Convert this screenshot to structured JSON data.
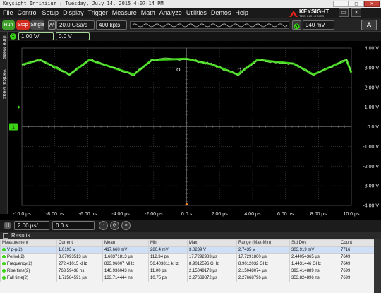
{
  "window": {
    "title": "Keysight Infiniium : Tuesday, July 14, 2015 4:07:14 PM",
    "buttons": [
      "–",
      "□",
      "✕"
    ]
  },
  "menu": {
    "items": [
      "File",
      "Control",
      "Setup",
      "Display",
      "Trigger",
      "Measure",
      "Math",
      "Analyze",
      "Utilities",
      "Demos",
      "Help"
    ],
    "logo_word": "KEYSIGHT",
    "logo_sub": "TECHNOLOGIES",
    "window_controls": [
      "▭",
      "✕"
    ]
  },
  "toolbar": {
    "run_label": "Run",
    "stop_label": "Stop",
    "single_label": "Single",
    "sample_rate": "20.0 GSa/s",
    "memory_depth": "400 kpts",
    "trigger_level": "940 mV",
    "autoscale_label": "A",
    "colors": {
      "run": "#3f9f2b",
      "stop": "#d12b1f",
      "single": "#4b4b4b"
    }
  },
  "sidetabs": [
    "Time Meas",
    "Vertical Meas"
  ],
  "channel1": {
    "badge": "1",
    "scale": "1.00 V/",
    "offset": "0.0 V",
    "color": "#3bd216"
  },
  "graticule": {
    "y_labels": [
      "4.00 V",
      "3.00 V",
      "2.00 V",
      "1.00 V",
      "0.0 V",
      "-1.00 V",
      "-2.00 V",
      "-3.00 V",
      "-4.00 V"
    ],
    "x_labels": [
      "-10.0 µs",
      "-8.00 µs",
      "-6.00 µs",
      "-4.00 µs",
      "-2.00 µs",
      "0.0 s",
      "2.00 µs",
      "4.00 µs",
      "6.00 µs",
      "8.00 µs",
      "10.0 µs"
    ],
    "ground_marker": "1",
    "trace_color": "#3bd216",
    "grid_color": "#3a3a3a"
  },
  "chart_data": {
    "type": "line",
    "title": "",
    "xlabel": "",
    "ylabel": "",
    "x_unit": "µs",
    "y_unit": "V",
    "xlim": [
      -10,
      10
    ],
    "ylim": [
      -4,
      4
    ],
    "grid": true,
    "series": [
      {
        "name": "",
        "x": [
          -10.0,
          -8.9,
          -7.1,
          -5.9,
          -3.2,
          -2.1,
          0.0,
          1.6,
          3.1,
          4.3,
          6.5,
          7.7,
          9.7,
          10.0
        ],
        "y": [
          3.15,
          3.4,
          2.65,
          3.4,
          2.65,
          3.4,
          3.45,
          3.15,
          2.65,
          3.4,
          3.2,
          2.65,
          3.4,
          2.75
        ]
      }
    ]
  },
  "horizontal": {
    "badge": "H",
    "time_scale": "2.00 µs/",
    "position": "0.0 s",
    "icons": [
      "◔",
      "⟳",
      "≡"
    ]
  },
  "results": {
    "title": "Results",
    "columns": [
      "Measurement",
      "Current",
      "Mean",
      "Min",
      "Max",
      "Range (Max-Min)",
      "Std Dev",
      "Count"
    ],
    "rows": [
      [
        "V p-p(2)",
        "1.0193 V",
        "417.660 mV",
        "280.4 mV",
        "3.0239 V",
        "2.7435 V",
        "303.919 mV",
        "7716"
      ],
      [
        "Period(2)",
        "3.67093513 µs",
        "1.68371813 µs",
        "112.34 ps",
        "17.7292983 µs",
        "17.7291860 µs",
        "2.44054365 µs",
        "7649"
      ],
      [
        "Frequency(2)",
        "272.41015 kHz",
        "833.96007 MHz",
        "56.403811 kHz",
        "8.9012596 GHz",
        "8.9012032 GHz",
        "1.4431446 GHz",
        "7649"
      ],
      [
        "Rise time(2)",
        "763.59438 ns",
        "146.936043 ns",
        "11.00 ps",
        "2.15049173 µs",
        "2.15048074 µs",
        "393.414889 ns",
        "7699"
      ],
      [
        "Fall time(2)",
        "1.72584591 µs",
        "133.714444 ns",
        "10.75 ps",
        "2.27669872 µs",
        "2.27668796 µs",
        "353.824896 ns",
        "7699"
      ]
    ]
  }
}
